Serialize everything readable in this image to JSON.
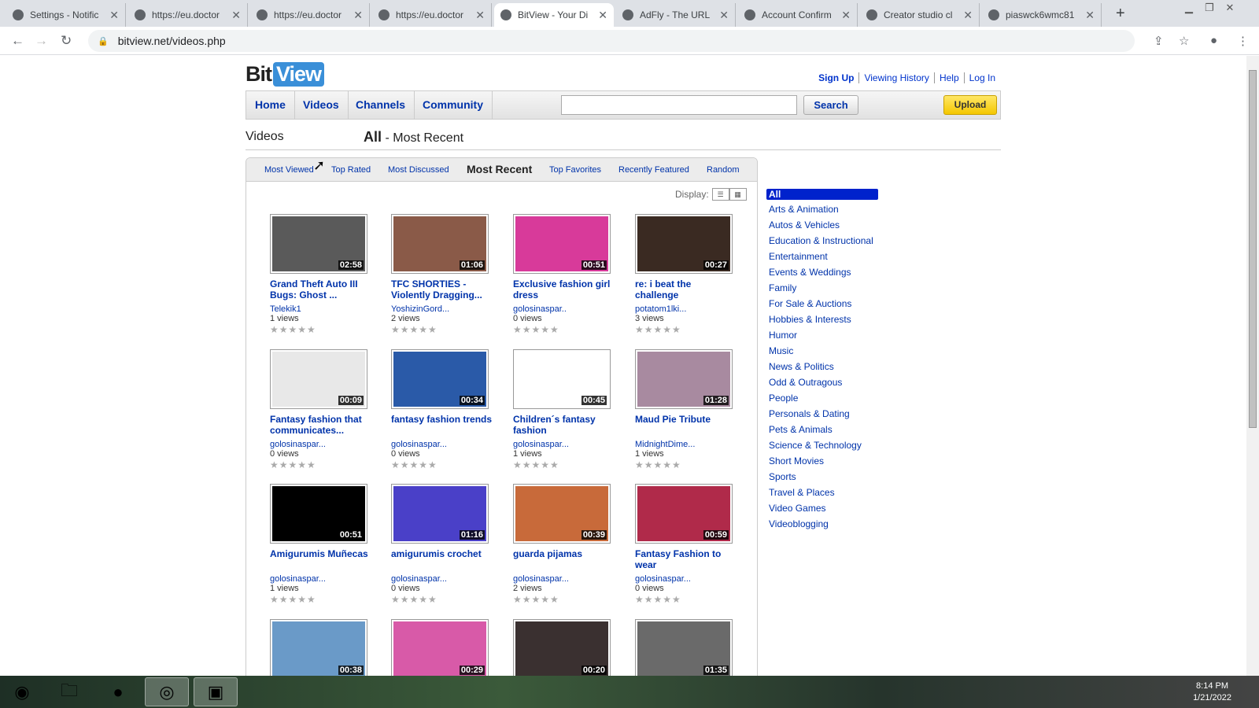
{
  "browser": {
    "tabs": [
      {
        "title": "Settings - Notific",
        "icon": "gear-icon"
      },
      {
        "title": "https://eu.doctor",
        "icon": "globe-icon"
      },
      {
        "title": "https://eu.doctor",
        "icon": "globe-icon"
      },
      {
        "title": "https://eu.doctor",
        "icon": "globe-icon"
      },
      {
        "title": "BitView - Your Di",
        "icon": "bitview-icon",
        "active": true
      },
      {
        "title": "AdFly - The URL",
        "icon": "adfly-icon"
      },
      {
        "title": "Account Confirm",
        "icon": "tumblr-icon"
      },
      {
        "title": "Creator studio cl",
        "icon": "reddit-icon"
      },
      {
        "title": "piaswck6wmc81",
        "icon": "globe-icon"
      }
    ],
    "url": "bitview.net/videos.php"
  },
  "site": {
    "logo_a": "Bit",
    "logo_b": "View",
    "toplinks": [
      "Sign Up",
      "Viewing History",
      "Help",
      "Log In"
    ],
    "nav": [
      "Home",
      "Videos",
      "Channels",
      "Community"
    ],
    "search_label": "Search",
    "upload_label": "Upload",
    "heading_left": "Videos",
    "heading_all": "All",
    "heading_rest": " - Most Recent"
  },
  "sort_tabs": [
    "Most Viewed",
    "Top Rated",
    "Most Discussed",
    "Most Recent",
    "Top Favorites",
    "Recently Featured",
    "Random"
  ],
  "display_label": "Display:",
  "videos": [
    {
      "title": "Grand Theft Auto III Bugs: Ghost ...",
      "duration": "02:58",
      "user": "Telekik1",
      "views": "1 views",
      "color": "#5a5a5a"
    },
    {
      "title": "TFC SHORTIES - Violently Dragging...",
      "duration": "01:06",
      "user": "YoshizinGord...",
      "views": "2 views",
      "color": "#8a5a48"
    },
    {
      "title": "Exclusive fashion girl dress",
      "duration": "00:51",
      "user": "golosinaspar..",
      "views": "0 views",
      "color": "#d83a9a"
    },
    {
      "title": "re: i beat the challenge",
      "duration": "00:27",
      "user": "potatom1lki...",
      "views": "3 views",
      "color": "#3a2a22"
    },
    {
      "title": "Fantasy fashion that communicates...",
      "duration": "00:09",
      "user": "golosinaspar...",
      "views": "0 views",
      "color": "#e8e8e8"
    },
    {
      "title": "fantasy fashion trends",
      "duration": "00:34",
      "user": "golosinaspar...",
      "views": "0 views",
      "color": "#2a5aa8"
    },
    {
      "title": "Children´s fantasy fashion",
      "duration": "00:45",
      "user": "golosinaspar...",
      "views": "1 views",
      "color": "#ffffff"
    },
    {
      "title": "Maud Pie Tribute",
      "duration": "01:28",
      "user": "MidnightDime...",
      "views": "1 views",
      "color": "#a88aa0"
    },
    {
      "title": "Amigurumis Muñecas",
      "duration": "00:51",
      "user": "golosinaspar...",
      "views": "1 views",
      "color": "#000000"
    },
    {
      "title": "amigurumis crochet",
      "duration": "01:16",
      "user": "golosinaspar...",
      "views": "0 views",
      "color": "#4a40c8"
    },
    {
      "title": "guarda pijamas",
      "duration": "00:39",
      "user": "golosinaspar...",
      "views": "2 views",
      "color": "#c86a3a"
    },
    {
      "title": "Fantasy Fashion to wear",
      "duration": "00:59",
      "user": "golosinaspar...",
      "views": "0 views",
      "color": "#b02a4a"
    },
    {
      "title": "",
      "duration": "00:38",
      "user": "",
      "views": "",
      "color": "#6a9ac8"
    },
    {
      "title": "",
      "duration": "00:29",
      "user": "",
      "views": "",
      "color": "#d85aa8"
    },
    {
      "title": "",
      "duration": "00:20",
      "user": "",
      "views": "",
      "color": "#3a3030"
    },
    {
      "title": "",
      "duration": "01:35",
      "user": "",
      "views": "",
      "color": "#6a6a6a"
    }
  ],
  "stars": "★★★★★",
  "categories": [
    "All",
    "Arts & Animation",
    "Autos & Vehicles",
    "Education & Instructional",
    "Entertainment",
    "Events & Weddings",
    "Family",
    "For Sale & Auctions",
    "Hobbies & Interests",
    "Humor",
    "Music",
    "News & Politics",
    "Odd & Outragous",
    "People",
    "Personals & Dating",
    "Pets & Animals",
    "Science & Technology",
    "Short Movies",
    "Sports",
    "Travel & Places",
    "Video Games",
    "Videoblogging"
  ],
  "taskbar": {
    "time": "8:14 PM",
    "date": "1/21/2022"
  }
}
